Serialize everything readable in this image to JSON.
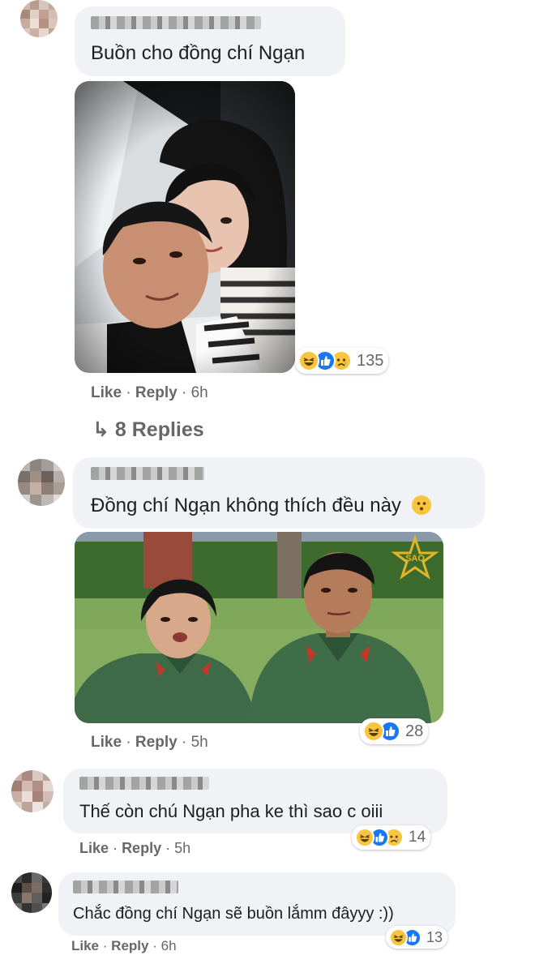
{
  "comments": [
    {
      "text": "Buồn cho đồng chí Ngạn",
      "reactions": {
        "icons": [
          "laugh-icon",
          "like-icon",
          "sad-icon"
        ],
        "count": "135"
      },
      "actions": {
        "like": "Like",
        "reply": "Reply",
        "separator": "·",
        "time": "6h"
      },
      "replies_link": {
        "arrow": "↳",
        "label": "8 Replies"
      }
    },
    {
      "text": "Đồng chí Ngạn không thích đều này",
      "reactions": {
        "icons": [
          "laugh-icon",
          "like-icon"
        ],
        "count": "28"
      },
      "actions": {
        "like": "Like",
        "reply": "Reply",
        "separator": "·",
        "time": "5h"
      }
    },
    {
      "text": "Thế còn chú Ngạn pha ke thì sao c oiii",
      "reactions": {
        "icons": [
          "laugh-icon",
          "like-icon",
          "sad-icon"
        ],
        "count": "14"
      },
      "actions": {
        "like": "Like",
        "reply": "Reply",
        "separator": "·",
        "time": "5h"
      }
    },
    {
      "text": "Chắc đồng chí Ngạn sẽ buồn lắmm đâyyy :))",
      "reactions": {
        "icons": [
          "laugh-icon",
          "like-icon"
        ],
        "count": "13"
      },
      "actions": {
        "like": "Like",
        "reply": "Reply",
        "separator": "·",
        "time": "6h"
      }
    }
  ],
  "photo2_watermark": "SAO",
  "colors": {
    "bubble": "#f0f2f5",
    "meta": "#65676b",
    "like_blue": "#1877f2",
    "reaction_yellow": "#f7c53e"
  }
}
